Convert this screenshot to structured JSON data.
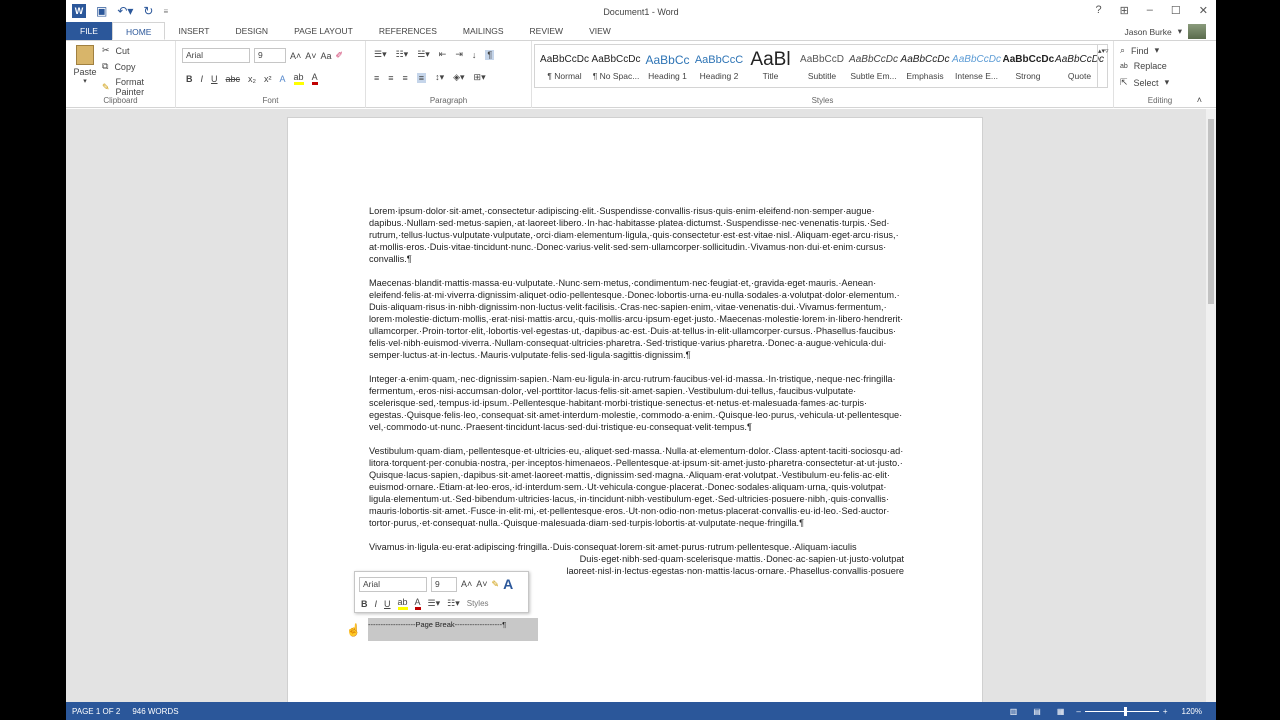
{
  "app": {
    "title": "Document1 - Word",
    "user": "Jason Burke"
  },
  "tabs": [
    "FILE",
    "HOME",
    "INSERT",
    "DESIGN",
    "PAGE LAYOUT",
    "REFERENCES",
    "MAILINGS",
    "REVIEW",
    "VIEW"
  ],
  "clipboard": {
    "paste": "Paste",
    "cut": "Cut",
    "copy": "Copy",
    "format_painter": "Format Painter",
    "label": "Clipboard"
  },
  "font": {
    "name": "Arial",
    "size": "9",
    "label": "Font",
    "case": "Aa"
  },
  "paragraph": {
    "label": "Paragraph"
  },
  "styles": {
    "label": "Styles",
    "items": [
      {
        "preview": "AaBbCcDc",
        "name": "¶ Normal"
      },
      {
        "preview": "AaBbCcDc",
        "name": "¶ No Spac..."
      },
      {
        "preview": "AaBbCc",
        "name": "Heading 1"
      },
      {
        "preview": "AaBbCcC",
        "name": "Heading 2"
      },
      {
        "preview": "AaBl",
        "name": "Title"
      },
      {
        "preview": "AaBbCcD",
        "name": "Subtitle"
      },
      {
        "preview": "AaBbCcDc",
        "name": "Subtle Em..."
      },
      {
        "preview": "AaBbCcDc",
        "name": "Emphasis"
      },
      {
        "preview": "AaBbCcDc",
        "name": "Intense E..."
      },
      {
        "preview": "AaBbCcDc",
        "name": "Strong"
      },
      {
        "preview": "AaBbCcDc",
        "name": "Quote"
      }
    ]
  },
  "editing": {
    "find": "Find",
    "replace": "Replace",
    "select": "Select",
    "label": "Editing"
  },
  "document": {
    "paragraphs": [
      "Lorem·ipsum·dolor·sit·amet,·consectetur·adipiscing·elit.·Suspendisse·convallis·risus·quis·enim·eleifend·non·semper·augue·dapibus.·Nullam·sed·metus·sapien,·at·laoreet·libero.·In·hac·habitasse·platea·dictumst.·Suspendisse·nec·venenatis·turpis.·Sed·rutrum,·tellus·luctus·vulputate·vulputate,·orci·diam·elementum·ligula,·quis·consectetur·est·est·vitae·nisl.·Aliquam·eget·arcu·risus,·at·mollis·eros.·Duis·vitae·tincidunt·nunc.·Donec·varius·velit·sed·sem·ullamcorper·sollicitudin.·Vivamus·non·dui·et·enim·cursus·convallis.¶",
      "Maecenas·blandit·mattis·massa·eu·vulputate.·Nunc·sem·metus,·condimentum·nec·feugiat·et,·gravida·eget·mauris.·Aenean·eleifend·felis·at·mi·viverra·dignissim·aliquet·odio·pellentesque.·Donec·lobortis·urna·eu·nulla·sodales·a·volutpat·dolor·elementum.·Duis·aliquam·risus·in·nibh·dignissim·non·luctus·velit·facilisis.·Cras·nec·sapien·enim,·vitae·venenatis·dui.·Vivamus·fermentum,·lorem·molestie·dictum·mollis,·erat·nisi·mattis·arcu,·quis·mollis·arcu·ipsum·eget·justo.·Maecenas·molestie·lorem·in·libero·hendrerit·ullamcorper.·Proin·tortor·elit,·lobortis·vel·egestas·ut,·dapibus·ac·est.·Duis·at·tellus·in·elit·ullamcorper·cursus.·Phasellus·faucibus·felis·vel·nibh·euismod·viverra.·Nullam·consequat·ultricies·pharetra.·Sed·tristique·varius·pharetra.·Donec·a·augue·vehicula·dui·semper·luctus·at·in·lectus.·Mauris·vulputate·felis·sed·ligula·sagittis·dignissim.¶",
      "Integer·a·enim·quam,·nec·dignissim·sapien.·Nam·eu·ligula·in·arcu·rutrum·faucibus·vel·id·massa.·In·tristique,·neque·nec·fringilla·fermentum,·eros·nisi·accumsan·dolor,·vel·porttitor·lacus·felis·sit·amet·sapien.·Vestibulum·dui·tellus,·faucibus·vulputate·scelerisque·sed,·tempus·id·ipsum.·Pellentesque·habitant·morbi·tristique·senectus·et·netus·et·malesuada·fames·ac·turpis·egestas.·Quisque·felis·leo,·consequat·sit·amet·interdum·molestie,·commodo·a·enim.·Quisque·leo·purus,·vehicula·ut·pellentesque·vel,·commodo·ut·nunc.·Praesent·tincidunt·lacus·sed·dui·tristique·eu·consequat·velit·tempus.¶",
      "Vestibulum·quam·diam,·pellentesque·et·ultricies·eu,·aliquet·sed·massa.·Nulla·at·elementum·dolor.·Class·aptent·taciti·sociosqu·ad·litora·torquent·per·conubia·nostra,·per·inceptos·himenaeos.·Pellentesque·at·ipsum·sit·amet·justo·pharetra·consectetur·at·ut·justo.·Quisque·lacus·sapien,·dapibus·sit·amet·laoreet·mattis,·dignissim·sed·magna.·Aliquam·erat·volutpat.·Vestibulum·eu·felis·ac·elit·euismod·ornare.·Etiam·at·leo·eros,·id·interdum·sem.·Ut·vehicula·congue·placerat.·Donec·sodales·aliquam·urna,·quis·volutpat·ligula·elementum·ut.·Sed·bibendum·ultricies·lacus,·in·tincidunt·nibh·vestibulum·eget.·Sed·ultricies·posuere·nibh,·quis·convallis·mauris·lobortis·sit·amet.·Fusce·in·elit·mi,·et·pellentesque·eros.·Ut·non·odio·non·metus·placerat·convallis·eu·id·leo.·Sed·auctor·tortor·purus,·et·consequat·nulla.·Quisque·malesuada·diam·sed·turpis·lobortis·at·vulputate·neque·fringilla.¶"
    ],
    "last_lines": [
      "Vivamus·in·ligula·eu·erat·adipiscing·fringilla.·Duis·consequat·lorem·sit·amet·purus·rutrum·pellentesque.·Aliquam·iaculis",
      "Duis·eget·nibh·sed·quam·scelerisque·mattis.·Donec·ac·sapien·ut·justo·volutpat",
      "laoreet·nisl·in·lectus·egestas·non·mattis·lacus·ornare.·Phasellus·convallis·posuere"
    ],
    "page_break": "-------------------Page Break-------------------¶"
  },
  "mini_toolbar": {
    "font": "Arial",
    "size": "9",
    "styles": "Styles"
  },
  "status": {
    "page": "PAGE 1 OF 2",
    "words": "946 WORDS",
    "zoom": "120%",
    "zoom_level": 120
  },
  "colors": {
    "accent": "#2b579a",
    "highlight": "#ffff00",
    "font_color": "#c00000"
  }
}
